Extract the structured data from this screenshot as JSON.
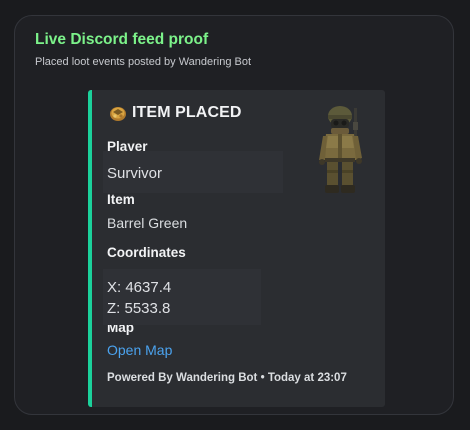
{
  "card": {
    "title": "Live Discord feed proof",
    "subtitle": "Placed loot events posted by Wandering Bot"
  },
  "embed": {
    "accent_color": "#1bd19b",
    "icon": "loot-box-icon",
    "title": "ITEM PLACED",
    "fields": {
      "player": {
        "name": "Player",
        "value": "Survivor"
      },
      "item": {
        "name": "Item",
        "value": "Barrel Green"
      },
      "coordinates": {
        "name": "Coordinates",
        "x": "X: 4637.4",
        "z": "Z: 5533.8"
      },
      "map": {
        "name": "Map",
        "link_text": "Open Map"
      }
    },
    "footer": {
      "author": "Powered By Wandering Bot",
      "separator": "•",
      "timestamp": "Today at 23:07"
    },
    "thumbnail": "survivor-character-image"
  }
}
